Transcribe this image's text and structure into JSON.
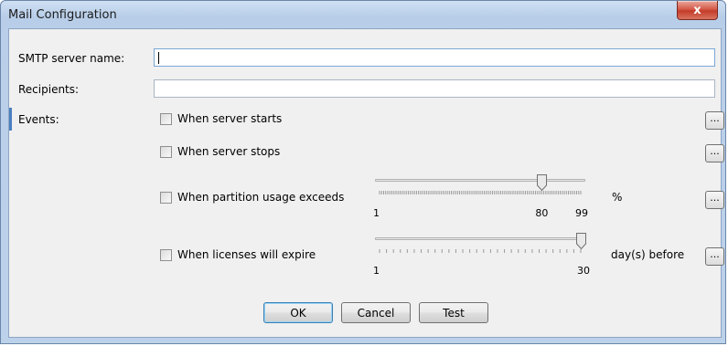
{
  "window": {
    "title": "Mail Configuration",
    "close_symbol": "x"
  },
  "form": {
    "smtp_label": "SMTP server name:",
    "smtp_value": "",
    "recipients_label": "Recipients:",
    "recipients_value": "",
    "events_label": "Events:"
  },
  "events": [
    {
      "label": "When server starts",
      "checked": false,
      "button": "..."
    },
    {
      "label": "When server stops",
      "checked": false,
      "button": "..."
    },
    {
      "label": "When partition usage exceeds",
      "checked": false,
      "button": "...",
      "slider": {
        "min": 1,
        "max": 99,
        "value": 80,
        "min_label": "1",
        "value_label": "80",
        "max_label": "99",
        "unit": "%"
      }
    },
    {
      "label": "When licenses will expire",
      "checked": false,
      "button": "...",
      "slider": {
        "min": 1,
        "max": 30,
        "value": 30,
        "min_label": "1",
        "max_label": "30",
        "unit": "day(s) before"
      }
    }
  ],
  "buttons": {
    "ok": "OK",
    "cancel": "Cancel",
    "test": "Test"
  }
}
